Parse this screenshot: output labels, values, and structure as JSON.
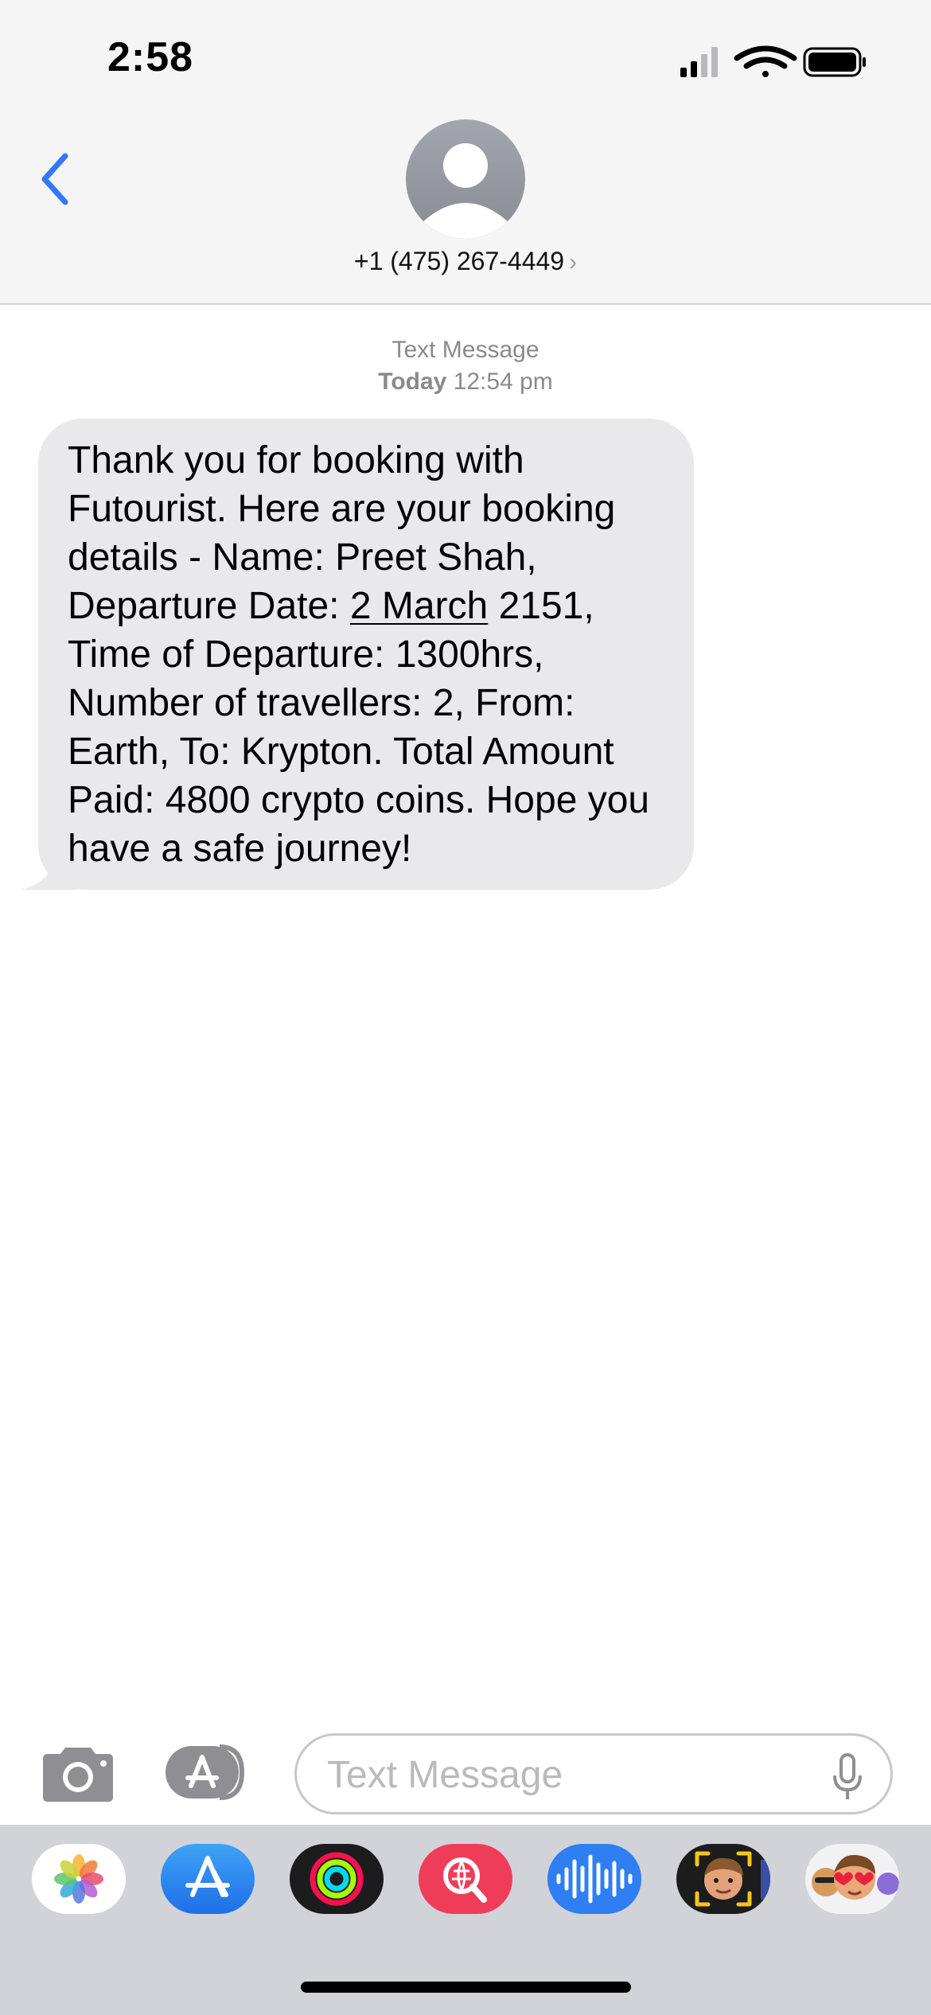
{
  "status_bar": {
    "time": "2:58"
  },
  "header": {
    "contact": "+1 (475) 267-4449",
    "chevron": "›"
  },
  "thread": {
    "meta_label": "Text Message",
    "meta_day": "Today",
    "meta_time": "12:54 pm",
    "message": {
      "part1": "Thank you for booking with Futourist. Here are your booking details - Name: Preet Shah, Departure Date: ",
      "date_link": "2 March",
      "part2": " 2151, Time of Departure: 1300hrs, Number of travellers: 2, From: Earth, To: Krypton. Total Amount Paid: 4800 crypto coins. Hope you have a safe journey!"
    }
  },
  "composer": {
    "placeholder": "Text Message"
  },
  "app_tray": [
    "photos-icon",
    "app-store-icon",
    "activity-icon",
    "images-search-icon",
    "audio-message-icon",
    "memoji-icon",
    "animoji-stickers-icon"
  ],
  "colors": {
    "accent": "#3478f6",
    "bubble": "#e9e9eb",
    "tray": "#d1d3d9"
  }
}
